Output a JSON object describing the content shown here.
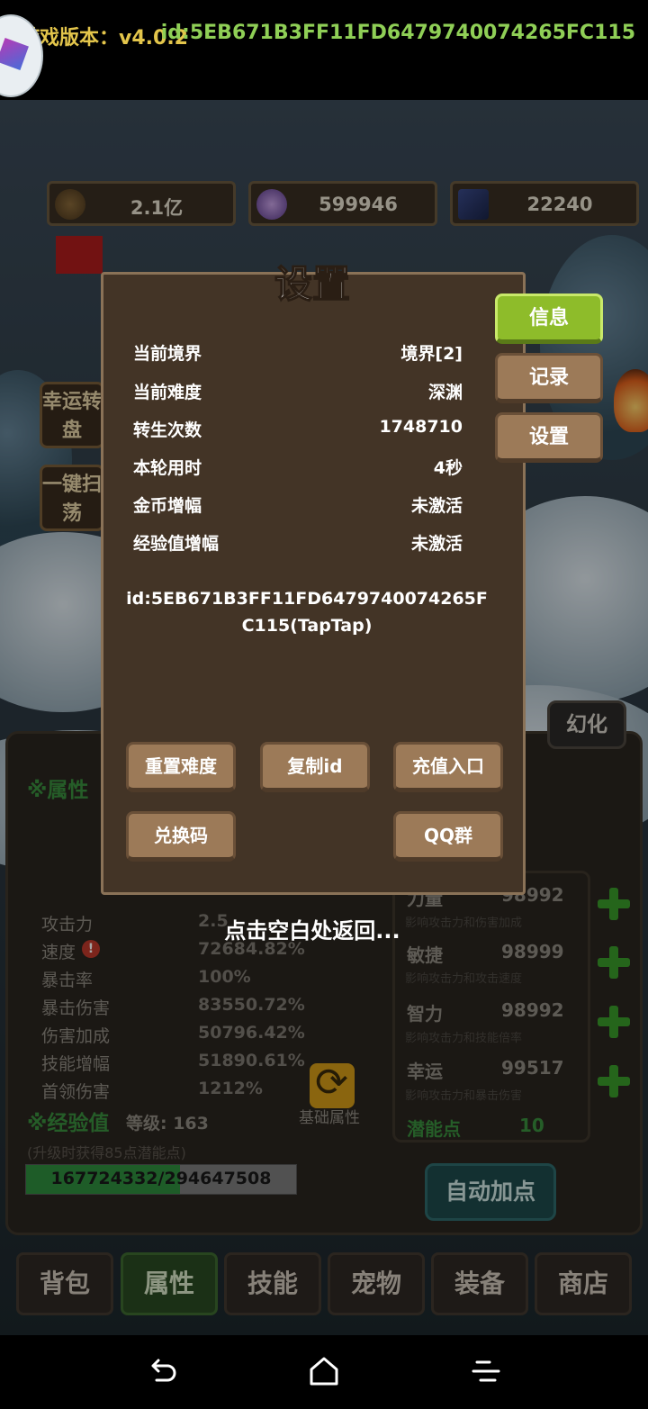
{
  "header": {
    "version": "游戏版本：v4.0.2",
    "user_id": "id:5EB671B3FF11FD6479740074265FC115"
  },
  "resources": [
    {
      "icon": "coin-icon",
      "value": "2.1亿"
    },
    {
      "icon": "crystal-icon",
      "value": "599946"
    },
    {
      "icon": "card-icon",
      "value": "22240"
    }
  ],
  "side_buttons": [
    "幸运转盘",
    "一键扫荡"
  ],
  "dialog": {
    "title": "设置",
    "tabs": [
      "信息",
      "记录",
      "设置"
    ],
    "info_rows": [
      {
        "label": "当前境界",
        "value": "境界[2]"
      },
      {
        "label": "当前难度",
        "value": "深渊"
      },
      {
        "label": "转生次数",
        "value": "1748710"
      },
      {
        "label": "本轮用时",
        "value": "4秒"
      },
      {
        "label": "金币增幅",
        "value": "未激活"
      },
      {
        "label": "经验值增幅",
        "value": "未激活"
      }
    ],
    "id_text": "id:5EB671B3FF11FD6479740074265FC115(TapTap)",
    "buttons": {
      "reset_difficulty": "重置难度",
      "copy_id": "复制id",
      "recharge": "充值入口",
      "redeem": "兑换码",
      "qq_group": "QQ群"
    },
    "tap_hint": "点击空白处返回..."
  },
  "huanhua": "幻化",
  "attributes": {
    "title": "※属性",
    "rows": [
      {
        "label": "攻击力",
        "value": "2.5"
      },
      {
        "label": "速度",
        "value": "72684.82%"
      },
      {
        "label": "暴击率",
        "value": "100%"
      },
      {
        "label": "暴击伤害",
        "value": "83550.72%"
      },
      {
        "label": "伤害加成",
        "value": "50796.42%"
      },
      {
        "label": "技能增幅",
        "value": "51890.61%"
      },
      {
        "label": "首领伤害",
        "value": "1212%"
      }
    ],
    "base_label": "基础属性"
  },
  "experience": {
    "title": "※经验值",
    "level": "等级: 163",
    "subtitle": "(升级时获得85点潜能点)",
    "progress_text": "167724332/294647508",
    "progress_fraction": 0.569
  },
  "stats": [
    {
      "name": "力量",
      "value": "98992",
      "desc": "影响攻击力和伤害加成"
    },
    {
      "name": "敏捷",
      "value": "98999",
      "desc": "影响攻击力和攻击速度"
    },
    {
      "name": "智力",
      "value": "98992",
      "desc": "影响攻击力和技能倍率"
    },
    {
      "name": "幸运",
      "value": "99517",
      "desc": "影响攻击力和暴击伤害"
    }
  ],
  "potential": {
    "label": "潜能点",
    "value": "10"
  },
  "auto_button": "自动加点",
  "bottom_tabs": [
    "背包",
    "属性",
    "技能",
    "宠物",
    "装备",
    "商店"
  ],
  "active_tab": "属性",
  "colors": {
    "accent_green": "#8ebc2a",
    "panel_brown": "#433426",
    "version_gold": "#e3c54b"
  }
}
